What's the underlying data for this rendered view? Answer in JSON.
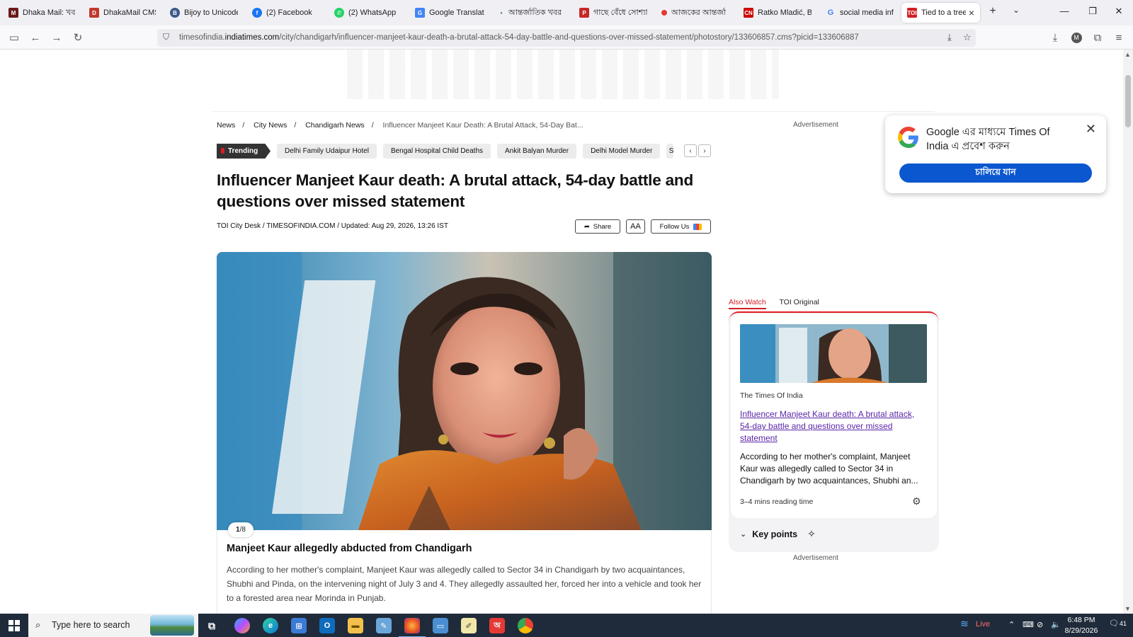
{
  "browser": {
    "tabs": [
      {
        "label": "Dhaka Mail: খবর, ",
        "favicon_color": "#6b1a1a"
      },
      {
        "label": "DhakaMail CMS",
        "favicon_color": "#c0392b"
      },
      {
        "label": "Bijoy to Unicode c",
        "favicon_color": "#3a5a8c"
      },
      {
        "label": "(2) Facebook",
        "favicon_color": "#1877f2"
      },
      {
        "label": "(2) WhatsApp",
        "favicon_color": "#25d366"
      },
      {
        "label": "Google Translate",
        "favicon_color": "#4285f4"
      },
      {
        "label": "আন্তর্জাতিক খবর ",
        "favicon_color": "#2b6cb0"
      },
      {
        "label": "গাছে বেঁধে সোশ্যাল",
        "favicon_color": "#c62828"
      },
      {
        "label": "আজকের আন্তর্জা",
        "favicon_color": "#e53935"
      },
      {
        "label": "Ratko Mladić, Bos",
        "favicon_color": "#cc0000"
      },
      {
        "label": "social media influ",
        "favicon_color": "#4285f4"
      },
      {
        "label": "Tied to a tree a",
        "favicon_color": "#d21f26",
        "active": true
      }
    ],
    "url_prefix": "timesofindia.",
    "url_domain": "indiatimes.com",
    "url_path": "/city/chandigarh/influencer-manjeet-kaur-death-a-brutal-attack-54-day-battle-and-questions-over-missed-statement/photostory/133606857.cms?picid=133606887"
  },
  "article": {
    "breadcrumb": [
      "News",
      "City News",
      "Chandigarh News",
      "Influencer Manjeet Kaur Death: A Brutal Attack, 54-Day Bat..."
    ],
    "trending_label": "Trending",
    "trending": [
      "Delhi Family Udaipur Hotel",
      "Bengal Hospital Child Deaths",
      "Ankit Balyan Murder",
      "Delhi Model Murder",
      "S"
    ],
    "headline": "Influencer Manjeet Kaur death: A brutal attack, 54-day battle and questions over missed statement",
    "byline": "TOI City Desk / TIMESOFINDIA.COM / Updated: Aug 29, 2026, 13:26 IST",
    "share_label": "Share",
    "font_size_label": "AA",
    "follow_label": "Follow Us",
    "slide_current": "1",
    "slide_total": "/8",
    "slide_title": "Manjeet Kaur allegedly abducted from Chandigarh",
    "slide_body": "According to her mother's complaint, Manjeet Kaur was allegedly called to Sector 34 in Chandigarh by two acquaintances, Shubhi and Pinda, on the intervening night of July 3 and 4. They allegedly assaulted her, forced her into a vehicle and took her to a forested area near Morinda in Punjab."
  },
  "rail": {
    "advertisement": "Advertisement",
    "tab_also_watch": "Also Watch",
    "tab_toi_original": "TOI Original",
    "source": "The Times Of India",
    "summary_title": "Influencer Manjeet Kaur death: A brutal attack, 54-day battle and questions over missed statement",
    "summary_text": "According to her mother's complaint, Manjeet Kaur was allegedly called to Sector 34 in Chandigarh by two acquaintances, Shubhi an...",
    "reading_time": "3–4 mins reading time",
    "key_points": "Key points",
    "advertisement_bottom": "Advertisement"
  },
  "google_popup": {
    "title": "Google এর মাধ্যমে Times Of India এ প্রবেশ করুন",
    "button": "চালিয়ে যান"
  },
  "taskbar": {
    "search_placeholder": "Type here to search",
    "weather": "Live",
    "time": "6:48 PM",
    "date": "8/29/2026",
    "notifications": "41"
  },
  "colors": {
    "accent_red": "#d21f26",
    "google_blue": "#0b57d0",
    "link_purple": "#5b26a8"
  }
}
